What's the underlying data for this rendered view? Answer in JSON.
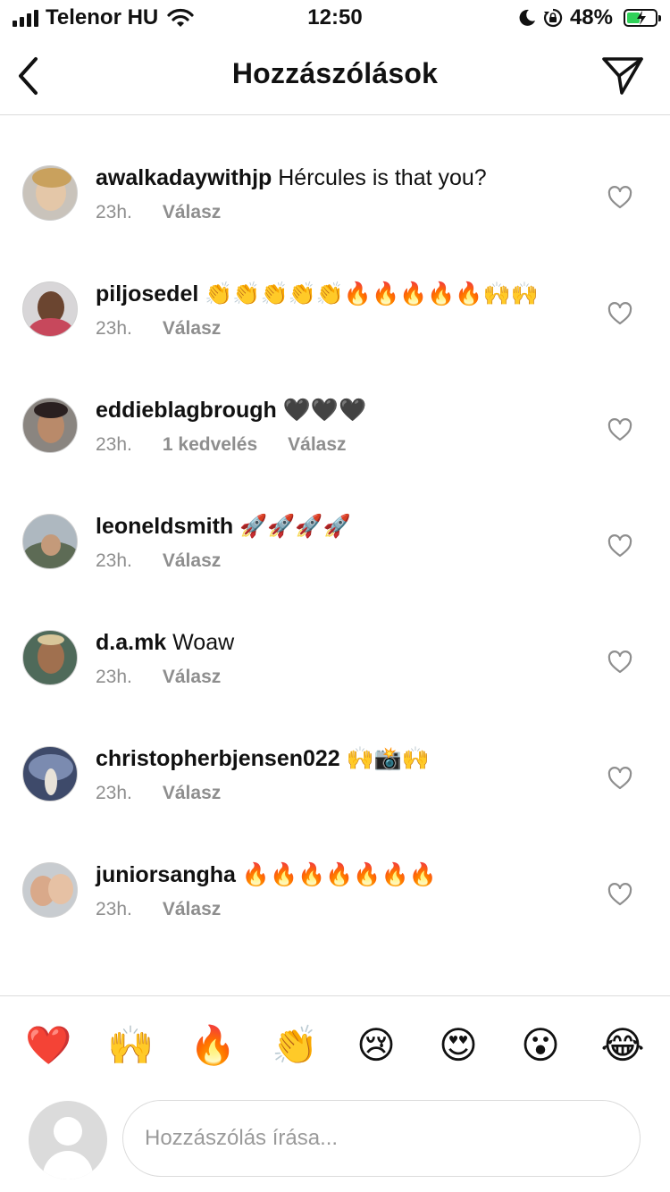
{
  "status_bar": {
    "carrier": "Telenor HU",
    "time": "12:50",
    "battery": "48%",
    "battery_level": 0.48,
    "icons": [
      "signal-icon",
      "wifi-icon",
      "moon-icon",
      "rotation-lock-icon",
      "battery-charging-icon"
    ]
  },
  "header": {
    "title": "Hozzászólások",
    "back_icon": "chevron-left-icon",
    "send_icon": "paper-plane-icon"
  },
  "comments": [
    {
      "username": "awalkadaywithjp",
      "text": "Hércules is that you?",
      "time": "23h.",
      "likes": "",
      "reply": "Válasz"
    },
    {
      "username": "piljosedel",
      "text": "👏👏👏👏👏🔥🔥🔥🔥🔥🙌🙌",
      "time": "23h.",
      "likes": "",
      "reply": "Válasz"
    },
    {
      "username": "eddieblagbrough",
      "text": "🖤🖤🖤",
      "time": "23h.",
      "likes": "1 kedvelés",
      "reply": "Válasz"
    },
    {
      "username": "leoneldsmith",
      "text": "🚀🚀🚀🚀",
      "time": "23h.",
      "likes": "",
      "reply": "Válasz"
    },
    {
      "username": "d.a.mk",
      "text": "Woaw",
      "time": "23h.",
      "likes": "",
      "reply": "Válasz"
    },
    {
      "username": "christopherbjensen022",
      "text": "🙌📸🙌",
      "time": "23h.",
      "likes": "",
      "reply": "Válasz"
    },
    {
      "username": "juniorsangha",
      "text": "🔥🔥🔥🔥🔥🔥🔥",
      "time": "23h.",
      "likes": "",
      "reply": "Válasz"
    }
  ],
  "quick_reactions": [
    "❤️",
    "🙌",
    "🔥",
    "👏",
    "😢",
    "😍",
    "😮",
    "😂"
  ],
  "composer": {
    "placeholder": "Hozzászólás írása...",
    "value": ""
  },
  "colors": {
    "text": "#111111",
    "secondary": "#8e8e8e",
    "divider": "#dbdbdb",
    "battery": "#2fd158"
  }
}
